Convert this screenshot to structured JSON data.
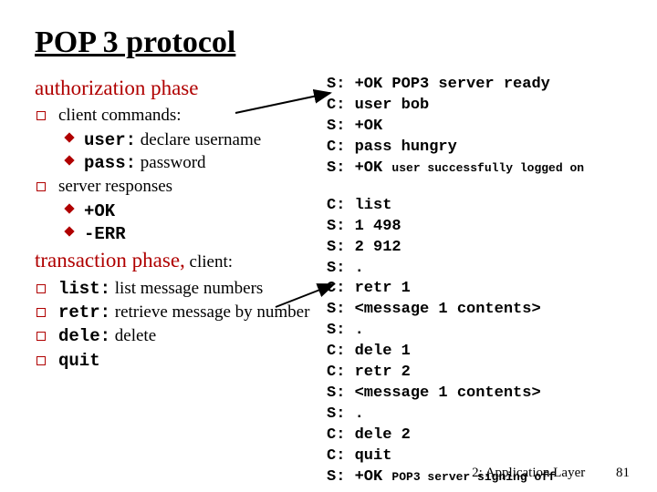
{
  "title": "POP 3 protocol",
  "left": {
    "subhead1": "authorization phase",
    "client_commands_label": "client commands:",
    "user_item": "user: declare username",
    "user_cmd": "user:",
    "user_rest": " declare username",
    "pass_item": "pass: password",
    "pass_cmd": "pass:",
    "pass_rest": " password",
    "server_responses_label": "server responses",
    "ok_item": "+OK",
    "err_item": "-ERR",
    "subhead2_a": "transaction phase,",
    "subhead2_b": " client:",
    "list_cmd": "list:",
    "list_rest": " list message numbers",
    "retr_cmd": "retr:",
    "retr_rest": " retrieve message by number",
    "dele_cmd": "dele:",
    "dele_rest": " delete",
    "quit_cmd": "quit"
  },
  "session": {
    "auth": [
      {
        "p": "S:",
        "t": " +OK POP3 server ready"
      },
      {
        "p": "C:",
        "t": " user bob"
      },
      {
        "p": "S:",
        "t": " +OK"
      },
      {
        "p": "C:",
        "t": " pass hungry"
      },
      {
        "p": "S:",
        "t": " +OK ",
        "small": "user successfully logged on"
      }
    ],
    "trans": [
      {
        "p": "C:",
        "t": " list"
      },
      {
        "p": "S:",
        "t": " 1 498"
      },
      {
        "p": "S:",
        "t": " 2 912"
      },
      {
        "p": "S:",
        "t": " ."
      },
      {
        "p": "C:",
        "t": " retr 1"
      },
      {
        "p": "S:",
        "t": " <message 1 contents>"
      },
      {
        "p": "S:",
        "t": " ."
      },
      {
        "p": "C:",
        "t": " dele 1"
      },
      {
        "p": "C:",
        "t": " retr 2"
      },
      {
        "p": "S:",
        "t": " <message 1 contents>"
      },
      {
        "p": "S:",
        "t": " ."
      },
      {
        "p": "C:",
        "t": " dele 2"
      },
      {
        "p": "C:",
        "t": " quit"
      },
      {
        "p": "S:",
        "t": " +OK ",
        "small": "POP3 server signing off"
      }
    ]
  },
  "footer": {
    "label": "2: Application Layer",
    "page": "81"
  }
}
